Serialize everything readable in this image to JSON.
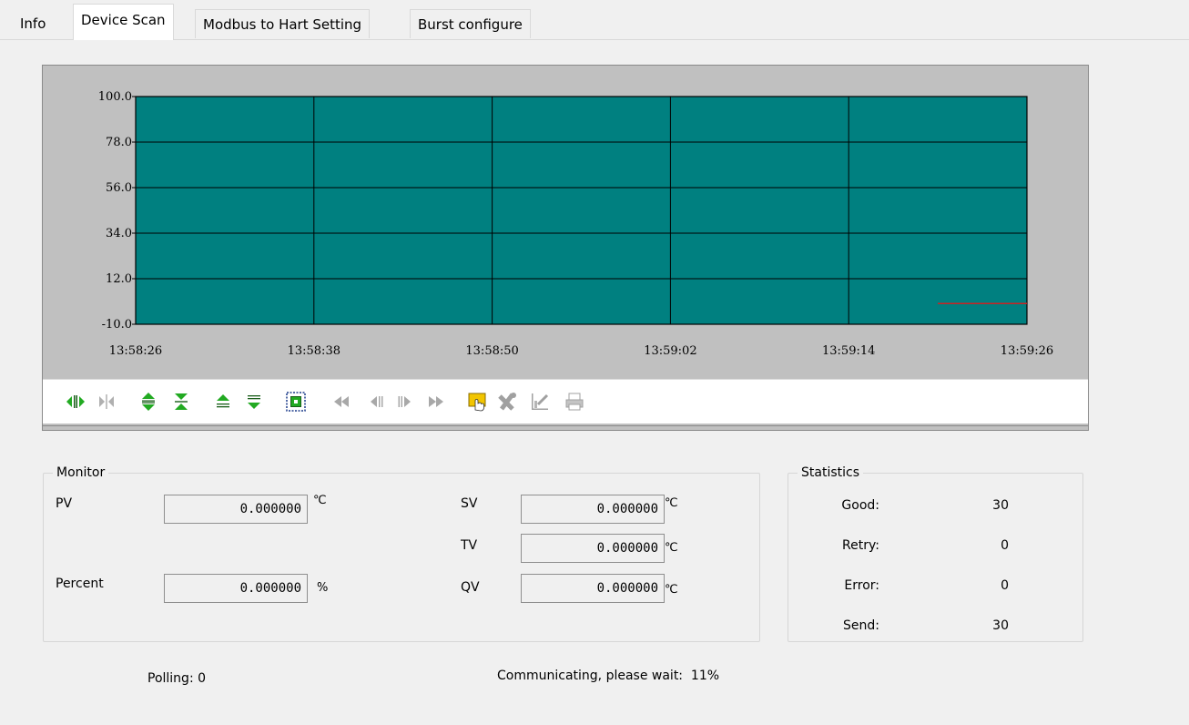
{
  "tabs": [
    {
      "label": "Info"
    },
    {
      "label": "Device Scan"
    },
    {
      "label": "Modbus to Hart Setting"
    },
    {
      "label": "Burst configure"
    }
  ],
  "active_tab": "Device Scan",
  "chart_data": {
    "type": "line",
    "y_ticks": [
      "100.0",
      "78.0",
      "56.0",
      "34.0",
      "12.0",
      "-10.0"
    ],
    "x_ticks": [
      "13:58:26",
      "13:58:38",
      "13:58:50",
      "13:59:02",
      "13:59:14",
      "13:59:26"
    ],
    "ylim": [
      -10,
      100
    ],
    "grid": true,
    "plot_bg": "#008080",
    "series": [
      {
        "color": "#cc2222",
        "x": [
          "13:59:20",
          "13:59:26"
        ],
        "values": [
          0.0,
          0.0
        ]
      }
    ]
  },
  "toolbar": {
    "icons": [
      "expand-horizontal-icon",
      "compress-horizontal-icon",
      "expand-vertical-icon",
      "compress-vertical-icon",
      "scroll-up-icon",
      "scroll-down-icon",
      "zoom-fit-icon",
      "scroll-first-icon",
      "step-back-icon",
      "step-forward-icon",
      "scroll-last-icon",
      "pan-hand-icon",
      "remove-icon",
      "edit-chart-icon",
      "print-icon"
    ]
  },
  "monitor": {
    "title": "Monitor",
    "pv": {
      "label": "PV",
      "value": "0.000000",
      "unit": "℃"
    },
    "percent": {
      "label": "Percent",
      "value": "0.000000",
      "unit": "%"
    },
    "sv": {
      "label": "SV",
      "value": "0.000000",
      "unit": "℃"
    },
    "tv": {
      "label": "TV",
      "value": "0.000000",
      "unit": "℃"
    },
    "qv": {
      "label": "QV",
      "value": "0.000000",
      "unit": "℃"
    }
  },
  "statistics": {
    "title": "Statistics",
    "good": {
      "label": "Good:",
      "value": "30"
    },
    "retry": {
      "label": "Retry:",
      "value": "0"
    },
    "error": {
      "label": "Error:",
      "value": "0"
    },
    "send": {
      "label": "Send:",
      "value": "30"
    }
  },
  "status": {
    "polling": "Polling: 0",
    "communicating": "Communicating, please wait:  11%"
  },
  "colors": {
    "grid": "#000000",
    "plot": "#008080",
    "trace": "#cc2222",
    "icon_green": "#22aa22",
    "icon_gray": "#9a9a9a"
  }
}
